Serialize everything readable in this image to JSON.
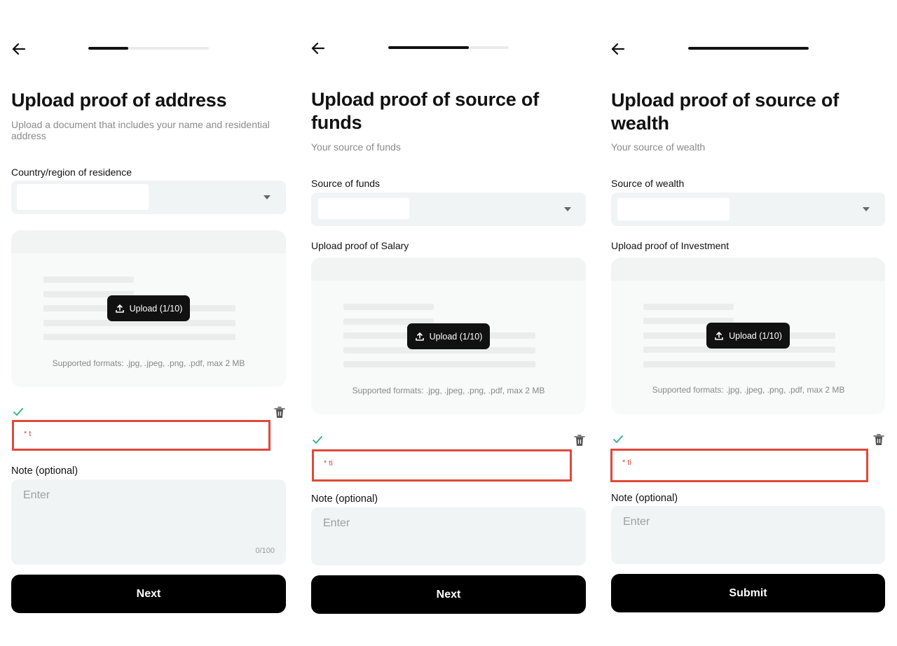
{
  "colors": {
    "accent": "#111111",
    "error_border": "#e0483b",
    "success_check": "#2bb07c",
    "field_bg": "#f1f4f4"
  },
  "screens": [
    {
      "title_line1": "Upload proof of address",
      "title_line2": "",
      "subtitle_line1": "Upload a document that includes your name and residential",
      "subtitle_line2": "address",
      "progress": 0.33,
      "field_label": "Country/region of residence",
      "upload_label": "",
      "upload_button": "Upload (1/10)",
      "formats": "Supported formats: .jpg, .jpeg, .png, .pdf, max 2 MB",
      "file_name": "* t",
      "note_label": "Note (optional)",
      "note_placeholder": "Enter",
      "char_count": "0/100",
      "button": "Next"
    },
    {
      "title_line1": "Upload proof of source of",
      "title_line2": "funds",
      "subtitle_line1": "Your source of funds",
      "subtitle_line2": "",
      "progress": 0.67,
      "field_label": "Source of funds",
      "upload_label": "Upload proof of Salary",
      "upload_button": "Upload (1/10)",
      "formats": "Supported formats: .jpg, .jpeg, .png, .pdf, max 2 MB",
      "file_name": "* ti",
      "note_label": "Note (optional)",
      "note_placeholder": "Enter",
      "char_count": "",
      "button": "Next"
    },
    {
      "title_line1": "Upload proof of source of",
      "title_line2": "wealth",
      "subtitle_line1": "Your source of wealth",
      "subtitle_line2": "",
      "progress": 1.0,
      "field_label": "Source of wealth",
      "upload_label": "Upload proof of Investment",
      "upload_button": "Upload (1/10)",
      "formats": "Supported formats: .jpg, .jpeg, .png, .pdf, max 2 MB",
      "file_name": "* ti",
      "note_label": "Note (optional)",
      "note_placeholder": "Enter",
      "char_count": "",
      "button": "Submit"
    }
  ]
}
